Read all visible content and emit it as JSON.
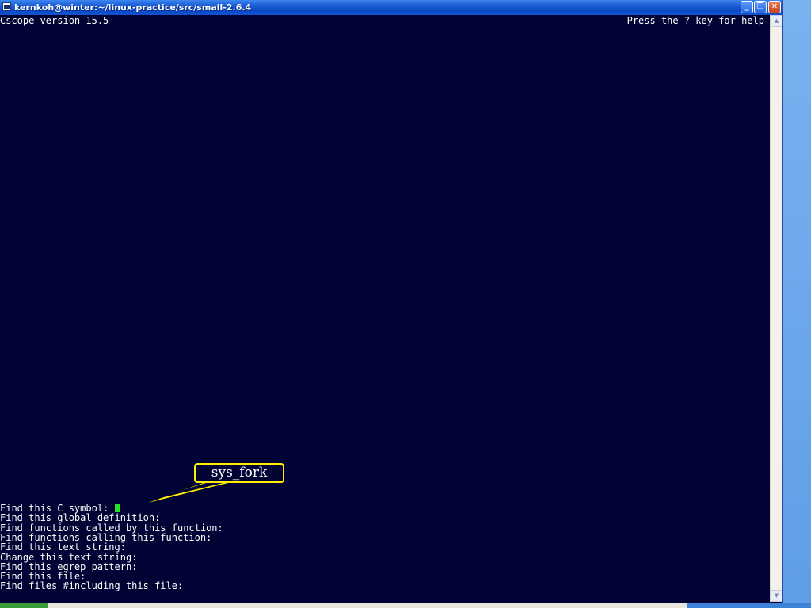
{
  "window": {
    "title": "kernkoh@winter:~/linux-practice/src/small-2.6.4",
    "minimize_glyph": "_",
    "maximize_glyph": "❐",
    "close_glyph": "✕"
  },
  "terminal": {
    "header_left": "Cscope version 15.5",
    "header_right": "Press the ? key for help",
    "prompts": [
      "Find this C symbol: ",
      "Find this global definition:",
      "Find functions called by this function:",
      "Find functions calling this function:",
      "Find this text string:",
      "Change this text string:",
      "Find this egrep pattern:",
      "Find this file:",
      "Find files #including this file:"
    ],
    "cursor_color": "#29e02a",
    "background_color": "#000333",
    "text_color": "#ffffff"
  },
  "callout": {
    "text": "sys_fork",
    "border_color": "#ffee00"
  },
  "scrollbar": {
    "up_glyph": "▲",
    "down_glyph": "▼"
  }
}
